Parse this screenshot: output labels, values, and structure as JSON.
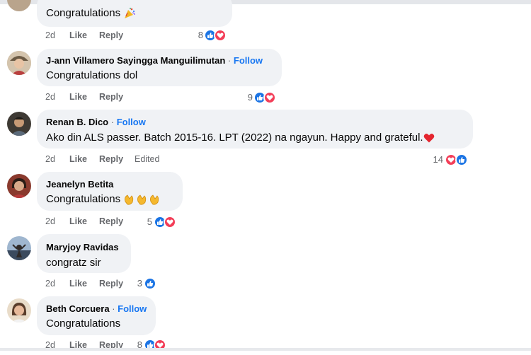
{
  "comments": [
    {
      "author": "",
      "follow": "",
      "text": "Congratulations",
      "emoji": "party-popper",
      "time": "2d",
      "like": "Like",
      "reply": "Reply",
      "edited": "",
      "reaction_count": "8",
      "reactions": [
        "like",
        "love"
      ]
    },
    {
      "author": "J-ann Villamero Sayingga Manguilimutan",
      "follow": "Follow",
      "text": "Congratulations dol",
      "time": "2d",
      "like": "Like",
      "reply": "Reply",
      "edited": "",
      "reaction_count": "9",
      "reactions": [
        "like",
        "love"
      ]
    },
    {
      "author": "Renan B. Dico",
      "follow": "Follow",
      "text": "Ako din ALS passer. Batch 2015-16. LPT (2022) na ngayun. Happy and grateful.",
      "emoji": "red-heart",
      "time": "2d",
      "like": "Like",
      "reply": "Reply",
      "edited": "Edited",
      "reaction_count": "14",
      "reactions": [
        "love",
        "like"
      ]
    },
    {
      "author": "Jeanelyn Betita",
      "follow": "",
      "text": "Congratulations",
      "emoji": "clapping-hands x3",
      "time": "2d",
      "like": "Like",
      "reply": "Reply",
      "edited": "",
      "reaction_count": "5",
      "reactions": [
        "like",
        "love"
      ]
    },
    {
      "author": "Maryjoy Ravidas",
      "follow": "",
      "text": "congratz sir",
      "time": "2d",
      "like": "Like",
      "reply": "Reply",
      "edited": "",
      "reaction_count": "3",
      "reactions": [
        "like"
      ]
    },
    {
      "author": "Beth Corcuera",
      "follow": "Follow",
      "text": "Congratulations",
      "time": "2d",
      "like": "Like",
      "reply": "Reply",
      "edited": "",
      "reaction_count": "8",
      "reactions": [
        "like",
        "love"
      ]
    }
  ],
  "colors": {
    "bubble": "#f0f2f5",
    "link": "#1877f2",
    "meta": "#65676b",
    "like_icon": "#1b74e4",
    "love_icon": "#f33e58"
  }
}
